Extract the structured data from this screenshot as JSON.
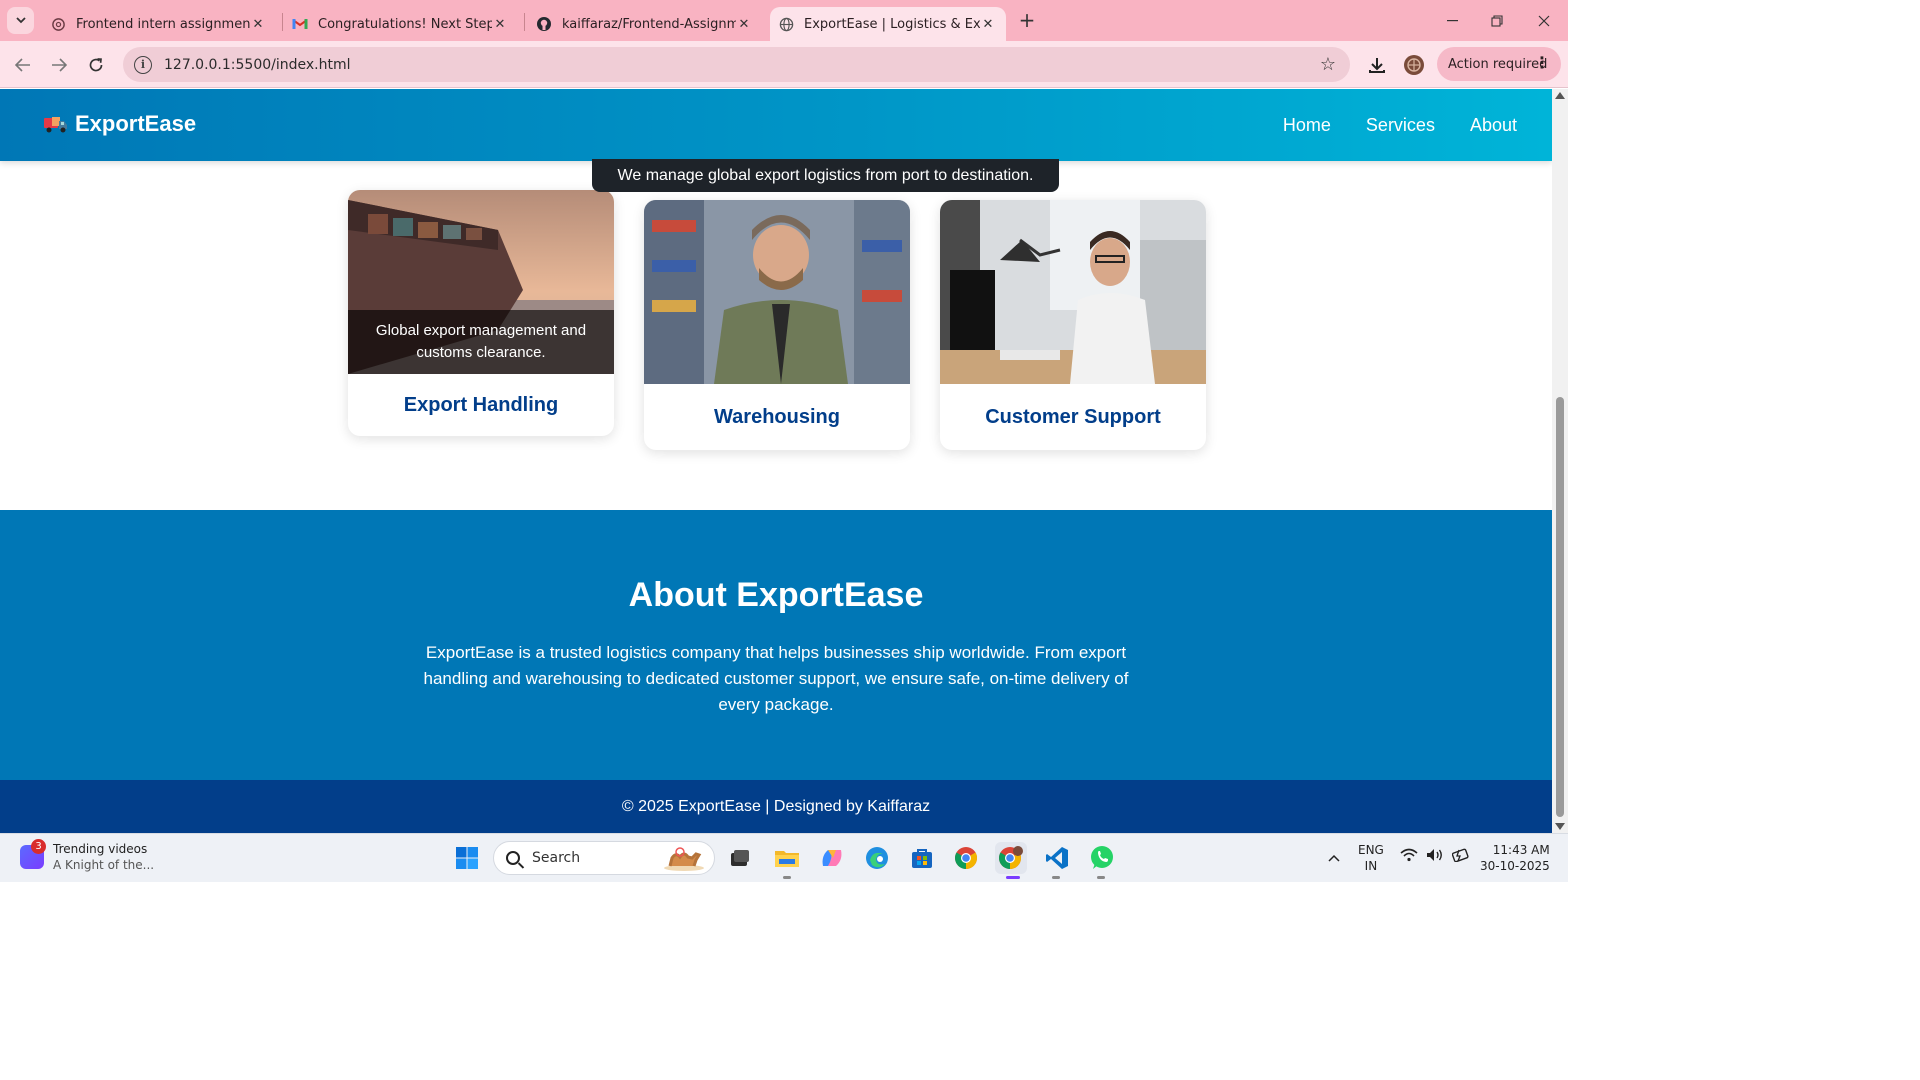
{
  "browser": {
    "tabs": [
      {
        "title": "Frontend intern assignment",
        "icon": "chatgpt-icon",
        "active": false
      },
      {
        "title": "Congratulations! Next Step - Fr",
        "icon": "gmail-icon",
        "active": false
      },
      {
        "title": "kaiffaraz/Frontend-Assignment",
        "icon": "github-icon",
        "active": false
      },
      {
        "title": "ExportEase | Logistics & Export",
        "icon": "globe-icon",
        "active": true
      }
    ],
    "url": "127.0.0.1:5500/index.html",
    "action_required": "Action required",
    "theme_color": "#f9b3c2"
  },
  "site": {
    "logo_text": "ExportEase",
    "nav": [
      "Home",
      "Services",
      "About"
    ],
    "tooltip": "We manage global export logistics from port to destination.",
    "cards": [
      {
        "title": "Export Handling",
        "overlay": "Global export management and customs clearance.",
        "image": "cargo-ship-photo"
      },
      {
        "title": "Warehousing",
        "image": "warehouse-worker-photo"
      },
      {
        "title": "Customer Support",
        "image": "support-agent-photo"
      }
    ],
    "about": {
      "heading": "About ExportEase",
      "text": "ExportEase is a trusted logistics company that helps businesses ship worldwide. From export handling and warehousing to dedicated customer support, we ensure safe, on-time delivery of every package."
    },
    "footer": "© 2025 ExportEase | Designed by Kaiffaraz",
    "colors": {
      "header": "#0077b6",
      "about_bg": "#0077b6",
      "footer_bg": "#023e8a",
      "card_title": "#023e8a"
    }
  },
  "taskbar": {
    "widget_badge": "3",
    "widget_title": "Trending videos",
    "widget_sub": "A Knight of the...",
    "search_placeholder": "Search",
    "lang_top": "ENG",
    "lang_bottom": "IN",
    "time": "11:43 AM",
    "date": "30-10-2025"
  }
}
